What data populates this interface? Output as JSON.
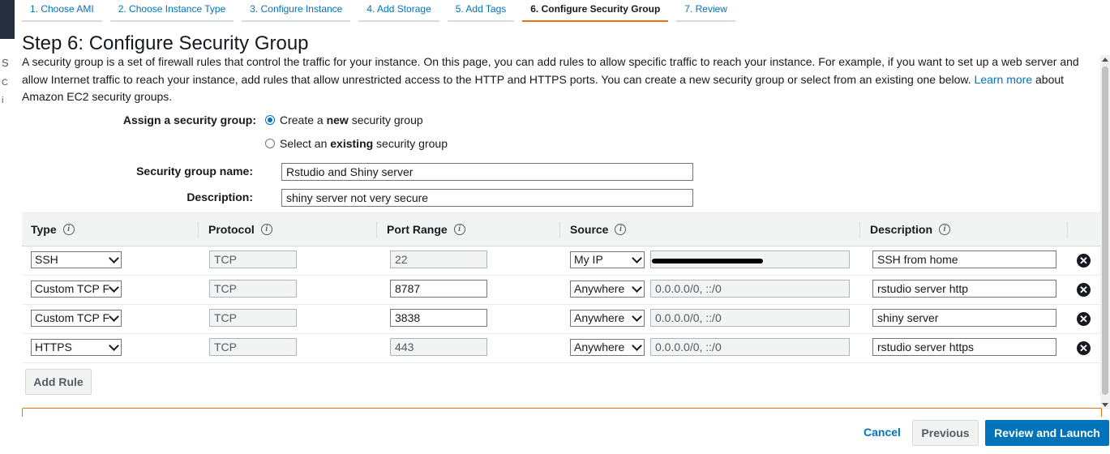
{
  "wizard": {
    "tabs": [
      {
        "label": "1. Choose AMI"
      },
      {
        "label": "2. Choose Instance Type"
      },
      {
        "label": "3. Configure Instance"
      },
      {
        "label": "4. Add Storage"
      },
      {
        "label": "5. Add Tags"
      },
      {
        "label": "6. Configure Security Group"
      },
      {
        "label": "7. Review"
      }
    ],
    "active_tab": 5
  },
  "left_ghost": [
    "S",
    "C",
    "i"
  ],
  "page": {
    "title": "Step 6: Configure Security Group",
    "intro": "A security group is a set of firewall rules that control the traffic for your instance. On this page, you can add rules to allow specific traffic to reach your instance. For example, if you want to set up a web server and allow Internet traffic to reach your instance, add rules that allow unrestricted access to the HTTP and HTTPS ports. You can create a new security group or select from an existing one below.",
    "learn_more": "Learn more",
    "intro_tail": "about Amazon EC2 security groups."
  },
  "form": {
    "assign_label": "Assign a security group:",
    "option_new": {
      "pre": "Create a ",
      "bold": "new",
      "post": " security group",
      "selected": true
    },
    "option_existing": {
      "pre": "Select an ",
      "bold": "existing",
      "post": " security group",
      "selected": false
    },
    "name_label": "Security group name:",
    "name_value": "Rstudio and Shiny server",
    "desc_label": "Description:",
    "desc_value": "shiny server not very secure"
  },
  "rules": {
    "headers": {
      "type": "Type",
      "protocol": "Protocol",
      "port_range": "Port Range",
      "source": "Source",
      "description": "Description"
    },
    "info_glyph": "i",
    "rows": [
      {
        "type": "SSH",
        "protocol": "TCP",
        "port": "22",
        "source": "My IP",
        "cidr": "",
        "description": "SSH from home",
        "port_editable": false
      },
      {
        "type": "Custom TCP F",
        "protocol": "TCP",
        "port": "8787",
        "source": "Anywhere",
        "cidr": "0.0.0.0/0, ::/0",
        "description": "rstudio server http",
        "port_editable": true
      },
      {
        "type": "Custom TCP F",
        "protocol": "TCP",
        "port": "3838",
        "source": "Anywhere",
        "cidr": "0.0.0.0/0, ::/0",
        "description": "shiny server",
        "port_editable": true
      },
      {
        "type": "HTTPS",
        "protocol": "TCP",
        "port": "443",
        "source": "Anywhere",
        "cidr": "0.0.0.0/0, ::/0",
        "description": "rstudio server https",
        "port_editable": false
      }
    ],
    "remove_glyph": "✕",
    "add_rule": "Add Rule"
  },
  "footer": {
    "cancel": "Cancel",
    "previous": "Previous",
    "review_launch": "Review and Launch"
  },
  "colors": {
    "link": "#0073bb",
    "accent": "#ec7211",
    "primary": "#0073bb"
  }
}
